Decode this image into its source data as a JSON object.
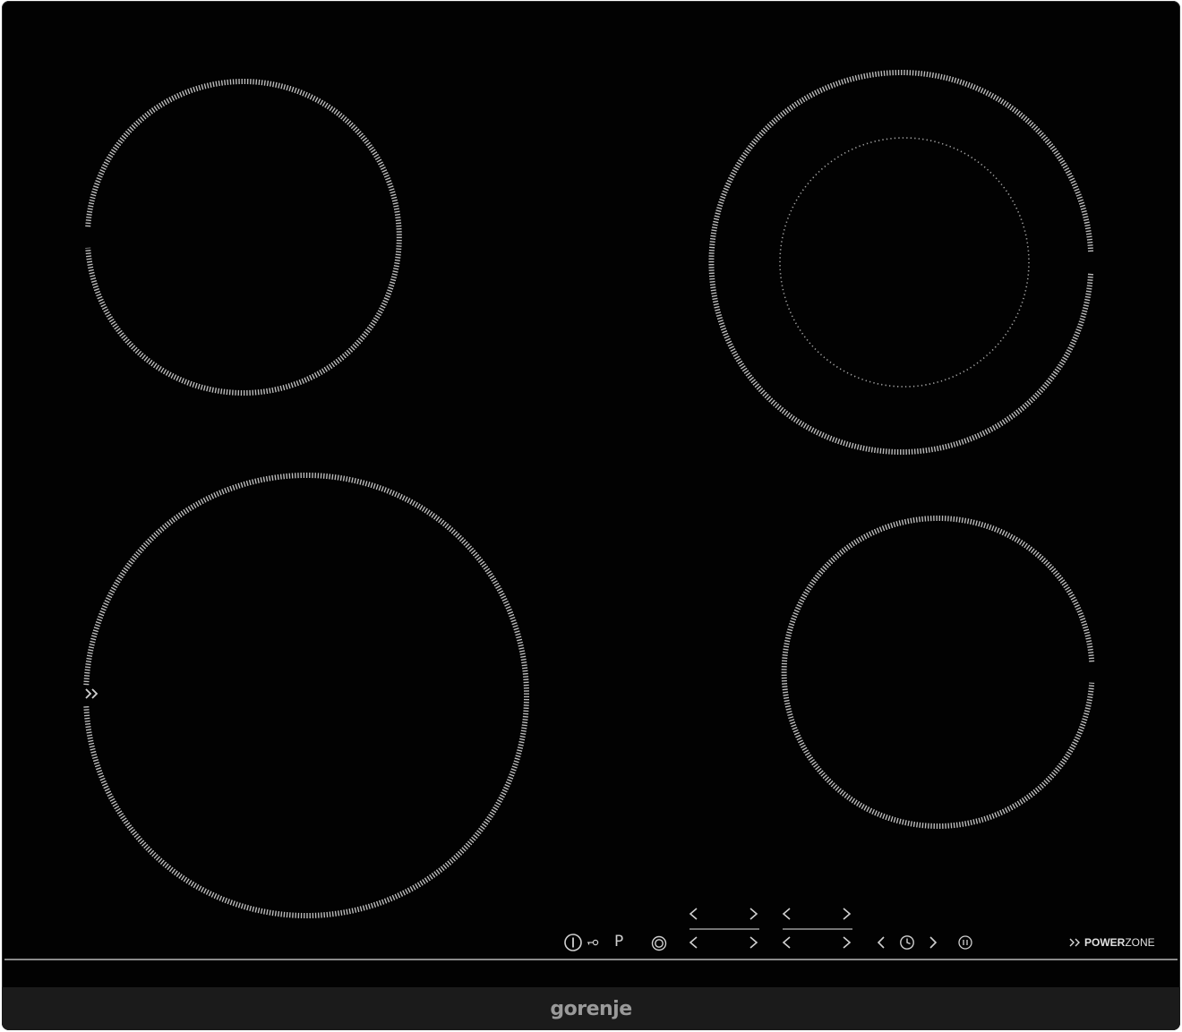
{
  "brand": {
    "name": "gorenje"
  },
  "colors": {
    "glass": "#020202",
    "frame": "#1b1b1b",
    "markings": "#cfcfcf",
    "brand": "#9a9a9a"
  },
  "zones": [
    {
      "id": "rear-left",
      "type": "single"
    },
    {
      "id": "rear-right",
      "type": "dual"
    },
    {
      "id": "front-left",
      "type": "single",
      "boost": true
    },
    {
      "id": "front-right",
      "type": "single"
    }
  ],
  "controls": {
    "power_icon": "power-icon",
    "lock_icon": "key-lock-icon",
    "program_label": "P",
    "dual_zone_icon": "dual-ring-icon",
    "timer_icon": "clock-icon",
    "pause_icon": "pause-icon",
    "powerzone": {
      "prefix": "POWER",
      "suffix": "ZONE",
      "icon": "double-chevron-icon"
    }
  }
}
